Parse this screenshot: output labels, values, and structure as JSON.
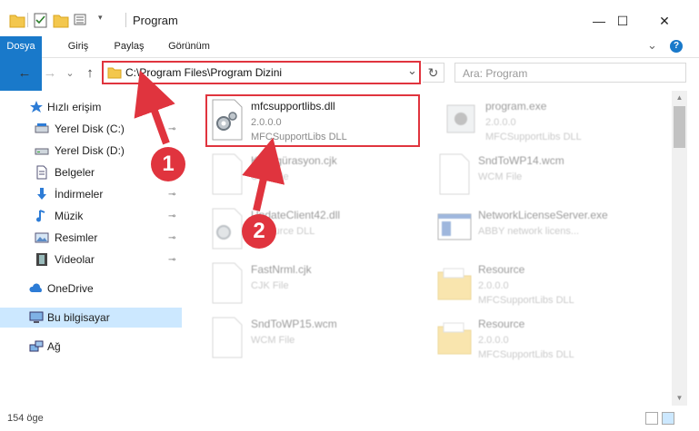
{
  "window": {
    "title": "Program",
    "minimize_glyph": "—",
    "maximize_glyph": "☐",
    "close_glyph": "✕"
  },
  "ribbon": {
    "tabs": [
      {
        "label": "Dosya"
      },
      {
        "label": "Giriş"
      },
      {
        "label": "Paylaş"
      },
      {
        "label": "Görünüm"
      }
    ],
    "expand_glyph": "⌄",
    "help_glyph": "?"
  },
  "nav": {
    "back_glyph": "←",
    "forward_glyph": "→",
    "history_glyph": "⌄",
    "up_glyph": "↑",
    "address": "C:\\Program Files\\Program Dizini",
    "address_dropdown_glyph": "⌄",
    "refresh_glyph": "↻",
    "search_placeholder": "Ara: Program",
    "search_glyph": "⚲"
  },
  "sidebar": {
    "items": [
      {
        "label": "Hızlı erişim",
        "icon": "star-icon"
      },
      {
        "label": "Yerel Disk (C:)",
        "icon": "drive-icon"
      },
      {
        "label": "Yerel Disk (D:)",
        "icon": "drive-icon"
      },
      {
        "label": "Belgeler",
        "icon": "document-icon"
      },
      {
        "label": "İndirmeler",
        "icon": "download-icon"
      },
      {
        "label": "Müzik",
        "icon": "music-icon"
      },
      {
        "label": "Resimler",
        "icon": "pictures-icon"
      },
      {
        "label": "Videolar",
        "icon": "video-icon"
      },
      {
        "label": "OneDrive",
        "icon": "cloud-icon"
      },
      {
        "label": "Bu bilgisayar",
        "icon": "computer-icon"
      },
      {
        "label": "Ağ",
        "icon": "network-icon"
      }
    ],
    "pin_glyph": "📌"
  },
  "files": [
    {
      "name": "mfcsupportlibs.dll",
      "line2": "2.0.0.0",
      "line3": "MFCSupportLibs DLL",
      "icon": "dll-gear-icon"
    },
    {
      "name": "program.exe",
      "line2": "2.0.0.0",
      "line3": "MFCSupportLibs DLL",
      "icon": "exe-icon"
    },
    {
      "name": "Konfigürasyon.cjk",
      "line2": "CJK File",
      "line3": "",
      "icon": "blank-file-icon"
    },
    {
      "name": "SndToWP14.wcm",
      "line2": "WCM File",
      "line3": "",
      "icon": "blank-file-icon"
    },
    {
      "name": "UpdateClient42.dll",
      "line2": "Resource DLL",
      "line3": "",
      "icon": "dll-gear-icon"
    },
    {
      "name": "NetworkLicenseServer.exe",
      "line2": "ABBY network licens...",
      "line3": "",
      "icon": "app-window-icon"
    },
    {
      "name": "FastNrml.cjk",
      "line2": "CJK File",
      "line3": "",
      "icon": "blank-file-icon"
    },
    {
      "name": "Resource",
      "line2": "2.0.0.0",
      "line3": "MFCSupportLibs DLL",
      "icon": "folder-icon"
    },
    {
      "name": "SndToWP15.wcm",
      "line2": "WCM File",
      "line3": "",
      "icon": "blank-file-icon"
    },
    {
      "name": "Resource",
      "line2": "2.0.0.0",
      "line3": "MFCSupportLibs DLL",
      "icon": "folder-icon"
    }
  ],
  "annotations": {
    "badge1": "1",
    "badge2": "2",
    "color": "#e0343e"
  },
  "status": {
    "item_count": "154 öge"
  },
  "colors": {
    "accent": "#1979ca",
    "selection": "#cce8ff",
    "highlight": "#e0343e"
  }
}
